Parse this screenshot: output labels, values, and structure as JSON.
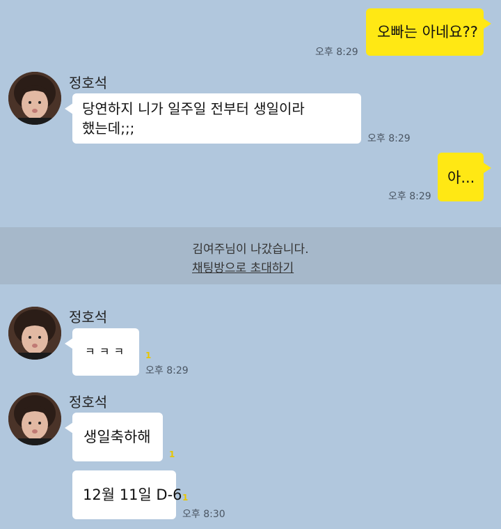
{
  "messages": {
    "m1": {
      "text": "오빠는 아네요??",
      "time": "오후 8:29"
    },
    "m2": {
      "sender": "정호석",
      "line1": "당연하지 니가 일주일 전부터 생일이라",
      "line2": "했는데;;;",
      "time": "오후 8:29"
    },
    "m3": {
      "text": "아...",
      "time": "오후 8:29"
    },
    "m4": {
      "sender": "정호석",
      "text": "ㅋㅋㅋ",
      "unread": "1",
      "time": "오후 8:29"
    },
    "m5": {
      "sender": "정호석",
      "text": "생일축하해",
      "unread": "1"
    },
    "m6": {
      "text": "12월 11일 D-6",
      "unread": "1",
      "time": "오후 8:30"
    }
  },
  "notice": {
    "text": "김여주님이 나갔습니다.",
    "link": "채팅방으로 초대하기"
  },
  "colors": {
    "background": "#b1c7dd",
    "my_bubble": "#ffe814",
    "other_bubble": "#ffffff",
    "notice_band": "#a6b8ca"
  }
}
